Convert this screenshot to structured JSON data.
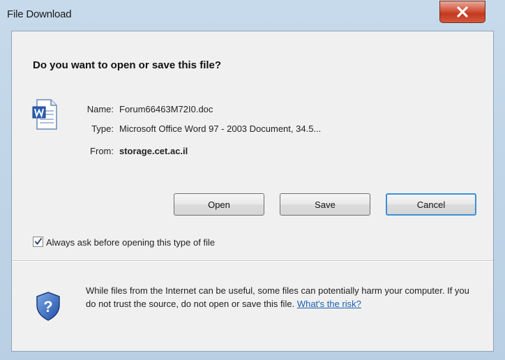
{
  "window": {
    "title": "File Download"
  },
  "dialog": {
    "question": "Do you want to open or save this file?",
    "file": {
      "name_label": "Name:",
      "name_value": "Forum66463M72I0.doc",
      "type_label": "Type:",
      "type_value": "Microsoft Office Word 97 - 2003 Document, 34.5...",
      "from_label": "From:",
      "from_value": "storage.cet.ac.il",
      "icon": "word-document-icon"
    },
    "buttons": {
      "open": "Open",
      "save": "Save",
      "cancel": "Cancel"
    },
    "checkbox": {
      "label": "Always ask before opening this type of file",
      "checked": true
    },
    "warning": {
      "text": "While files from the Internet can be useful, some files can potentially harm your computer. If you do not trust the source, do not open or save this file.",
      "link": "What's the risk?",
      "icon": "shield-question-icon"
    }
  }
}
